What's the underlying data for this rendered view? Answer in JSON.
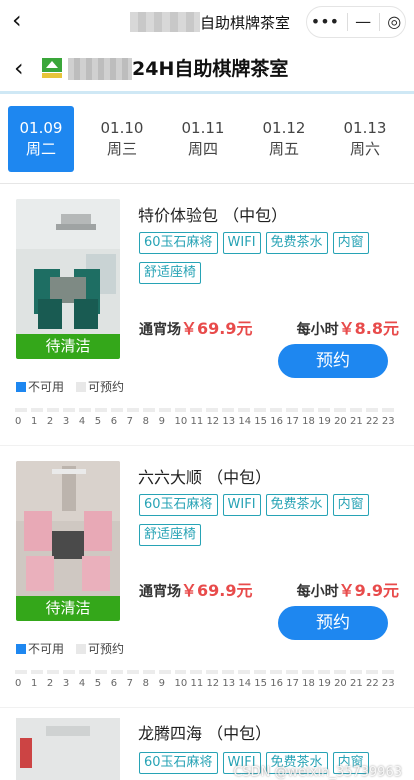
{
  "topbar": {
    "title": "自助棋牌茶室",
    "capsule_more": "•••",
    "capsule_minimize": "—",
    "capsule_close": "◎"
  },
  "header": {
    "shop_name": "24H自助棋牌茶室"
  },
  "dates": [
    {
      "date": "01.09",
      "weekday": "周二",
      "active": true
    },
    {
      "date": "01.10",
      "weekday": "周三",
      "active": false
    },
    {
      "date": "01.11",
      "weekday": "周四",
      "active": false
    },
    {
      "date": "01.12",
      "weekday": "周五",
      "active": false
    },
    {
      "date": "01.13",
      "weekday": "周六",
      "active": false
    }
  ],
  "rooms": [
    {
      "name": "特价体验包 （中包）",
      "status": "待清洁",
      "tags": [
        "60玉石麻将",
        "WIFI",
        "免费茶水",
        "内窗",
        "舒适座椅"
      ],
      "overnight_label": "通宵场",
      "overnight_price": "￥69.9元",
      "hourly_label": "每小时",
      "hourly_price": "￥8.8元",
      "book_label": "预约"
    },
    {
      "name": "六六大顺 （中包）",
      "status": "待清洁",
      "tags": [
        "60玉石麻将",
        "WIFI",
        "免费茶水",
        "内窗",
        "舒适座椅"
      ],
      "overnight_label": "通宵场",
      "overnight_price": "￥69.9元",
      "hourly_label": "每小时",
      "hourly_price": "￥9.9元",
      "book_label": "预约"
    },
    {
      "name": "龙腾四海 （中包）",
      "tags": [
        "60玉石麻将",
        "WIFI",
        "免费茶水",
        "内窗"
      ]
    }
  ],
  "legend": {
    "unavailable": "不可用",
    "available": "可预约"
  },
  "hours": [
    "0",
    "1",
    "2",
    "3",
    "4",
    "5",
    "6",
    "7",
    "8",
    "9",
    "10",
    "11",
    "12",
    "13",
    "14",
    "15",
    "16",
    "17",
    "18",
    "19",
    "20",
    "21",
    "22",
    "23"
  ],
  "watermark": "CSDN @weixin_35739963",
  "colors": {
    "primary": "#1e87f0",
    "status_green": "#34a71a",
    "price_red": "#e84b4b",
    "tag_teal": "#27a3b5"
  }
}
